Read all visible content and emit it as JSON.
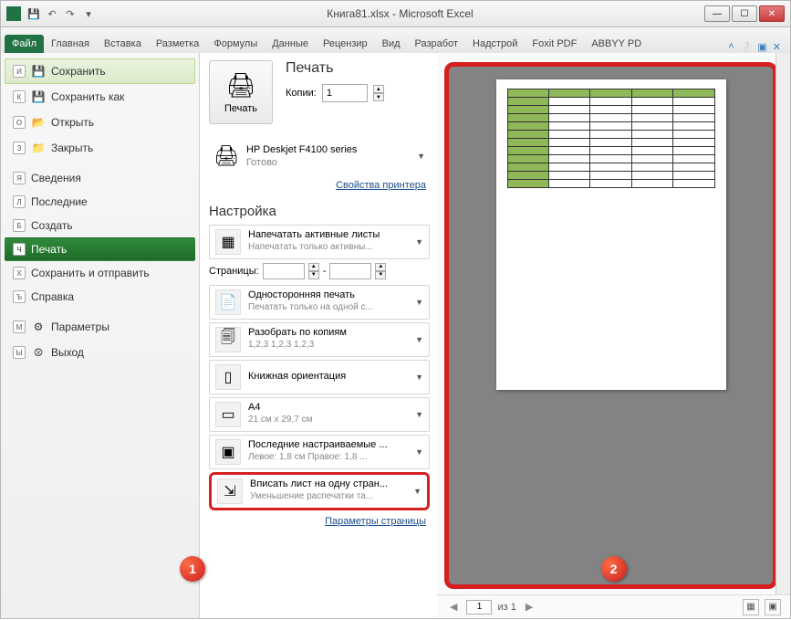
{
  "window": {
    "title": "Книга81.xlsx - Microsoft Excel"
  },
  "ribbon": {
    "tabs": [
      "Файл",
      "Главная",
      "Вставка",
      "Разметка",
      "Формулы",
      "Данные",
      "Рецензир",
      "Вид",
      "Разработ",
      "Надстрой",
      "Foxit PDF",
      "ABBYY PD"
    ]
  },
  "sidebar": {
    "items": [
      {
        "key": "И",
        "icon": "💾",
        "label": "Сохранить"
      },
      {
        "key": "К",
        "icon": "💾",
        "label": "Сохранить как"
      },
      {
        "key": "О",
        "icon": "📂",
        "label": "Открыть"
      },
      {
        "key": "З",
        "icon": "📁",
        "label": "Закрыть"
      },
      {
        "key": "Я",
        "icon": "",
        "label": "Сведения"
      },
      {
        "key": "Л",
        "icon": "",
        "label": "Последние"
      },
      {
        "key": "Б",
        "icon": "",
        "label": "Создать"
      },
      {
        "key": "Ч",
        "icon": "",
        "label": "Печать"
      },
      {
        "key": "Х",
        "icon": "",
        "label": "Сохранить и отправить"
      },
      {
        "key": "Ъ",
        "icon": "",
        "label": "Справка"
      },
      {
        "key": "М",
        "icon": "⚙",
        "label": "Параметры"
      },
      {
        "key": "Ы",
        "icon": "⮾",
        "label": "Выход"
      }
    ]
  },
  "print": {
    "heading": "Печать",
    "button": "Печать",
    "copies_label": "Копии:",
    "copies_value": "1",
    "printer_name": "HP Deskjet F4100 series",
    "printer_status": "Готово",
    "printer_props": "Свойства принтера",
    "settings_heading": "Настройка",
    "opt_sheets": {
      "title": "Напечатать активные листы",
      "sub": "Напечатать только активны..."
    },
    "pages_label": "Страницы:",
    "pages_sep": "-",
    "opt_sides": {
      "title": "Односторонняя печать",
      "sub": "Печатать только на одной с..."
    },
    "opt_collate": {
      "title": "Разобрать по копиям",
      "sub": "1,2,3   1,2,3   1,2,3"
    },
    "opt_orient": {
      "title": "Книжная ориентация",
      "sub": ""
    },
    "opt_size": {
      "title": "A4",
      "sub": "21 см x 29,7 см"
    },
    "opt_margins": {
      "title": "Последние настраиваемые ...",
      "sub": "Левое: 1,8 см   Правое: 1,8 ..."
    },
    "opt_fit": {
      "title": "Вписать лист на одну стран...",
      "sub": "Уменьшение распечатки та..."
    },
    "page_setup": "Параметры страницы"
  },
  "preview": {
    "page_current": "1",
    "page_of": "из 1",
    "callout1": "1",
    "callout2": "2"
  }
}
